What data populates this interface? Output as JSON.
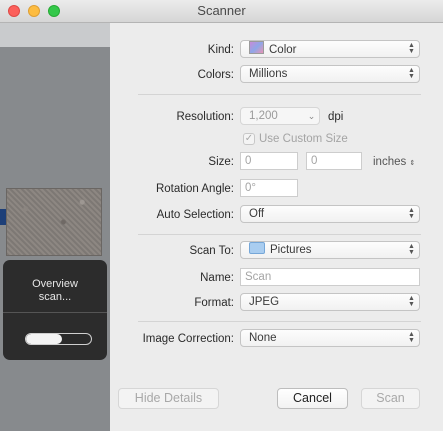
{
  "window": {
    "title": "Scanner"
  },
  "overview": {
    "message_line1": "Overview",
    "message_line2": "scan...",
    "progress": 0.55
  },
  "form": {
    "kind": {
      "label": "Kind:",
      "value": "Color",
      "icon": "color-swatch-icon"
    },
    "colors": {
      "label": "Colors:",
      "value": "Millions"
    },
    "resolution": {
      "label": "Resolution:",
      "value": "1,200",
      "unit": "dpi"
    },
    "use_custom_size": {
      "label": "Use Custom Size",
      "checked": true
    },
    "size": {
      "label": "Size:",
      "width": "0",
      "height": "0",
      "unit": "inches"
    },
    "rotation": {
      "label": "Rotation Angle:",
      "placeholder": "0°"
    },
    "auto_selection": {
      "label": "Auto Selection:",
      "value": "Off"
    },
    "scan_to": {
      "label": "Scan To:",
      "value": "Pictures",
      "icon": "folder-icon"
    },
    "name": {
      "label": "Name:",
      "placeholder": "Scan"
    },
    "format": {
      "label": "Format:",
      "value": "JPEG"
    },
    "image_correction": {
      "label": "Image Correction:",
      "value": "None"
    }
  },
  "buttons": {
    "hide_details": "Hide Details",
    "cancel": "Cancel",
    "scan": "Scan"
  }
}
